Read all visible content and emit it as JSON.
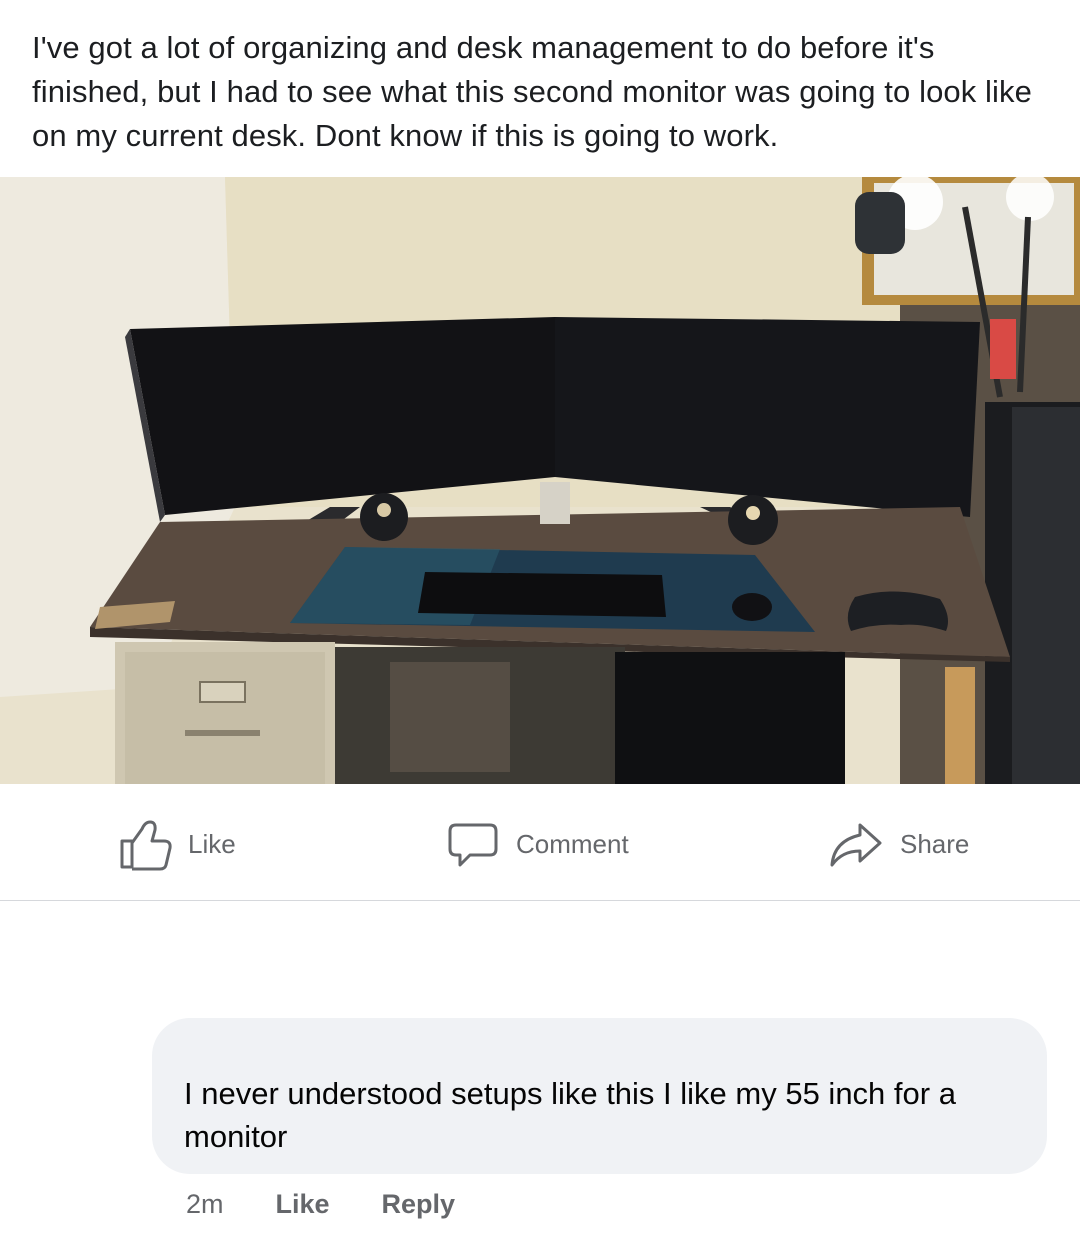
{
  "post": {
    "text": "I've got a lot of organizing and desk management to do before it's finished, but I had to see what this second monitor was going to look like on my current desk. Dont know if this is going to work."
  },
  "actions": {
    "like_label": "Like",
    "comment_label": "Comment",
    "share_label": "Share"
  },
  "comment": {
    "text": "I never understood setups like this I like my 55 inch for a monitor",
    "time": "2m",
    "like_label": "Like",
    "reply_label": "Reply"
  },
  "icons": {
    "like": "thumbs-up-icon",
    "comment": "speech-bubble-icon",
    "share": "share-arrow-icon"
  },
  "colors": {
    "meta_text": "#65676b",
    "bubble_bg": "#f0f2f5",
    "divider": "#d6d8dc"
  }
}
